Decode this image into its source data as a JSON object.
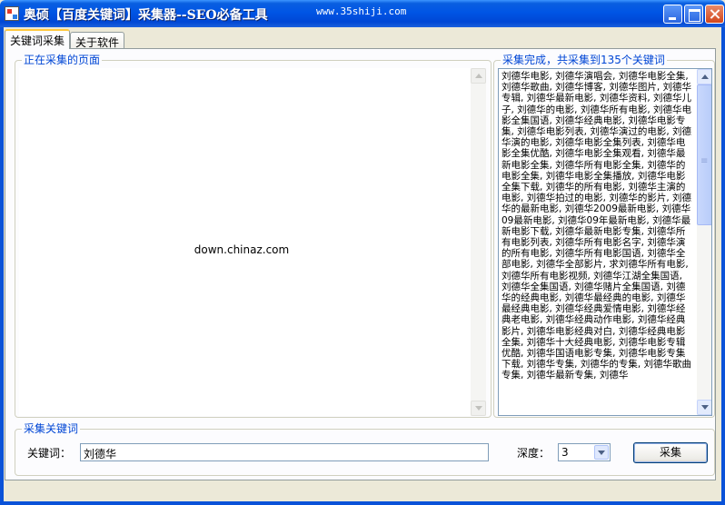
{
  "window": {
    "title": "奥硕【百度关键词】采集器--SEO必备工具",
    "url_text": "www.35shiji.com"
  },
  "tabs": [
    {
      "label": "关键词采集",
      "active": true
    },
    {
      "label": "关于软件",
      "active": false
    }
  ],
  "browser_panel": {
    "title": "正在采集的页面",
    "center_text": "down.chinaz.com"
  },
  "results_panel": {
    "title": "采集完成，共采集到135个关键词",
    "text": "刘德华电影, 刘德华演唱会, 刘德华电影全集, 刘德华歌曲, 刘德华博客, 刘德华图片, 刘德华专辑, 刘德华最新电影, 刘德华资料, 刘德华儿子, 刘德华的电影, 刘德华所有电影, 刘德华电影全集国语, 刘德华经典电影, 刘德华电影专集, 刘德华电影列表, 刘德华演过的电影, 刘德华演的电影, 刘德华电影全集列表, 刘德华电影全集优酷, 刘德华电影全集观看, 刘德华最新电影全集, 刘德华所有电影全集, 刘德华的电影全集, 刘德华电影全集播放, 刘德华电影全集下载, 刘德华的所有电影, 刘德华主演的电影, 刘德华拍过的电影, 刘德华的影片, 刘德华的最新电影, 刘德华2009最新电影, 刘德华09最新电影, 刘德华09年最新电影, 刘德华最新电影下载, 刘德华最新电影专集, 刘德华所有电影列表, 刘德华所有电影名字, 刘德华演的所有电影, 刘德华所有电影国语, 刘德华全部电影, 刘德华全部影片, 求刘德华所有电影, 刘德华所有电影视频, 刘德华江湖全集国语, 刘德华全集国语, 刘德华赌片全集国语, 刘德华的经典电影, 刘德华最经典的电影, 刘德华最经典电影, 刘德华经典爱情电影, 刘德华经典老电影, 刘德华经典动作电影, 刘德华经典影片, 刘德华电影经典对白, 刘德华经典电影全集, 刘德华十大经典电影, 刘德华电影专辑优酷, 刘德华国语电影专集, 刘德华电影专集下载, 刘德华专集, 刘德华的专集, 刘德华歌曲专集, 刘德华最新专集, 刘德华"
  },
  "keyword_panel": {
    "title": "采集关键词",
    "keyword_label": "关键词：",
    "keyword_value": "刘德华",
    "depth_label": "深度：",
    "depth_value": "3",
    "collect_button": "采集"
  }
}
